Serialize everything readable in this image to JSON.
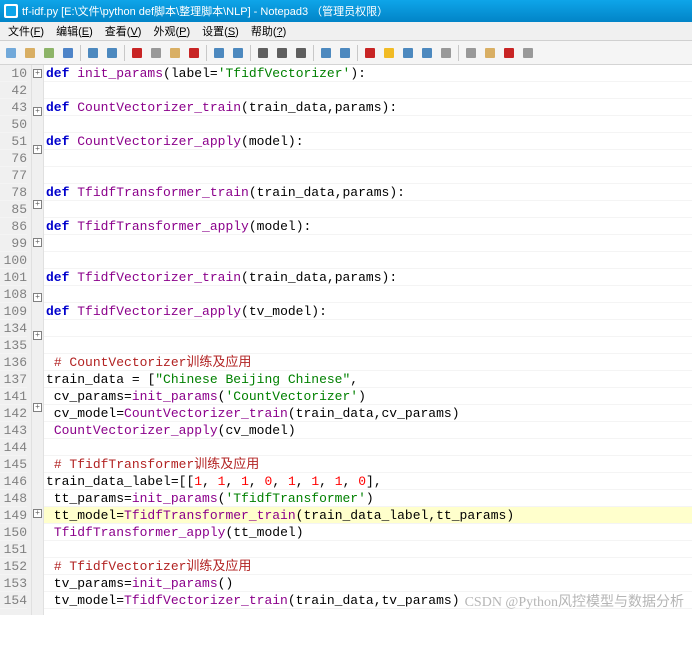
{
  "title": "tf-idf.py [E:\\文件\\python def脚本\\整理脚本\\NLP] - Notepad3 （管理员权限）",
  "menus": [
    "文件(F)",
    "编辑(E)",
    "查看(V)",
    "外观(P)",
    "设置(S)",
    "帮助(?)"
  ],
  "menu_ul": [
    "F",
    "E",
    "V",
    "P",
    "S",
    "?"
  ],
  "watermark": "CSDN @Python风控模型与数据分析",
  "lines": [
    {
      "n": 10,
      "f": "+",
      "t": [
        [
          "kw",
          "def "
        ],
        [
          "fn",
          "init_params"
        ],
        [
          "op",
          "("
        ],
        [
          "var",
          "label"
        ],
        [
          "op",
          "="
        ],
        [
          "str",
          "'TfidfVectorizer'"
        ],
        [
          "op",
          ")"
        ],
        [
          "op",
          ":"
        ]
      ]
    },
    {
      "n": 42,
      "f": "",
      "t": []
    },
    {
      "n": 43,
      "f": "+",
      "t": [
        [
          "kw",
          "def "
        ],
        [
          "fn",
          "CountVectorizer_train"
        ],
        [
          "op",
          "("
        ],
        [
          "var",
          "train_data"
        ],
        [
          "op",
          ","
        ],
        [
          "var",
          "params"
        ],
        [
          "op",
          ")"
        ],
        [
          "op",
          ":"
        ]
      ]
    },
    {
      "n": 50,
      "f": "",
      "t": []
    },
    {
      "n": 51,
      "f": "+",
      "t": [
        [
          "kw",
          "def "
        ],
        [
          "fn",
          "CountVectorizer_apply"
        ],
        [
          "op",
          "("
        ],
        [
          "var",
          "model"
        ],
        [
          "op",
          ")"
        ],
        [
          "op",
          ":"
        ]
      ]
    },
    {
      "n": 76,
      "f": "",
      "t": []
    },
    {
      "n": 77,
      "f": "",
      "t": []
    },
    {
      "n": 78,
      "f": "+",
      "t": [
        [
          "kw",
          "def "
        ],
        [
          "fn",
          "TfidfTransformer_train"
        ],
        [
          "op",
          "("
        ],
        [
          "var",
          "train_data"
        ],
        [
          "op",
          ","
        ],
        [
          "var",
          "params"
        ],
        [
          "op",
          ")"
        ],
        [
          "op",
          ":"
        ]
      ]
    },
    {
      "n": 85,
      "f": "",
      "t": []
    },
    {
      "n": 86,
      "f": "+",
      "t": [
        [
          "kw",
          "def "
        ],
        [
          "fn",
          "TfidfTransformer_apply"
        ],
        [
          "op",
          "("
        ],
        [
          "var",
          "model"
        ],
        [
          "op",
          ")"
        ],
        [
          "op",
          ":"
        ]
      ]
    },
    {
      "n": 99,
      "f": "",
      "t": []
    },
    {
      "n": 100,
      "f": "",
      "t": []
    },
    {
      "n": 101,
      "f": "+",
      "t": [
        [
          "kw",
          "def "
        ],
        [
          "fn",
          "TfidfVectorizer_train"
        ],
        [
          "op",
          "("
        ],
        [
          "var",
          "train_data"
        ],
        [
          "op",
          ","
        ],
        [
          "var",
          "params"
        ],
        [
          "op",
          ")"
        ],
        [
          "op",
          ":"
        ]
      ]
    },
    {
      "n": 108,
      "f": "",
      "t": []
    },
    {
      "n": 109,
      "f": "+",
      "t": [
        [
          "kw",
          "def "
        ],
        [
          "fn",
          "TfidfVectorizer_apply"
        ],
        [
          "op",
          "("
        ],
        [
          "var",
          "tv_model"
        ],
        [
          "op",
          ")"
        ],
        [
          "op",
          ":"
        ]
      ]
    },
    {
      "n": 134,
      "f": "",
      "t": []
    },
    {
      "n": 135,
      "f": "",
      "t": []
    },
    {
      "n": 136,
      "f": "",
      "t": [
        [
          "var",
          " "
        ],
        [
          "cmt",
          "# CountVectorizer训练及应用"
        ]
      ]
    },
    {
      "n": 137,
      "f": "+",
      "t": [
        [
          "var",
          "train_data "
        ],
        [
          "op",
          "= "
        ],
        [
          "op",
          "["
        ],
        [
          "str",
          "\"Chinese Beijing Chinese\""
        ],
        [
          "op",
          ","
        ]
      ]
    },
    {
      "n": 141,
      "f": "",
      "t": [
        [
          "var",
          " cv_params"
        ],
        [
          "op",
          "="
        ],
        [
          "fn",
          "init_params"
        ],
        [
          "op",
          "("
        ],
        [
          "str",
          "'CountVectorizer'"
        ],
        [
          "op",
          ")"
        ]
      ]
    },
    {
      "n": 142,
      "f": "",
      "t": [
        [
          "var",
          " cv_model"
        ],
        [
          "op",
          "="
        ],
        [
          "fn",
          "CountVectorizer_train"
        ],
        [
          "op",
          "("
        ],
        [
          "var",
          "train_data"
        ],
        [
          "op",
          ","
        ],
        [
          "var",
          "cv_params"
        ],
        [
          "op",
          ")"
        ]
      ]
    },
    {
      "n": 143,
      "f": "",
      "t": [
        [
          "var",
          " "
        ],
        [
          "fn",
          "CountVectorizer_apply"
        ],
        [
          "op",
          "("
        ],
        [
          "var",
          "cv_model"
        ],
        [
          "op",
          ")"
        ]
      ]
    },
    {
      "n": 144,
      "f": "",
      "t": []
    },
    {
      "n": 145,
      "f": "",
      "t": [
        [
          "var",
          " "
        ],
        [
          "cmt",
          "# TfidfTransformer训练及应用"
        ]
      ]
    },
    {
      "n": 146,
      "f": "+",
      "t": [
        [
          "var",
          "train_data_label"
        ],
        [
          "op",
          "="
        ],
        [
          "op",
          "[["
        ],
        [
          "num",
          "1"
        ],
        [
          "op",
          ", "
        ],
        [
          "num",
          "1"
        ],
        [
          "op",
          ", "
        ],
        [
          "num",
          "1"
        ],
        [
          "op",
          ", "
        ],
        [
          "num",
          "0"
        ],
        [
          "op",
          ", "
        ],
        [
          "num",
          "1"
        ],
        [
          "op",
          ", "
        ],
        [
          "num",
          "1"
        ],
        [
          "op",
          ", "
        ],
        [
          "num",
          "1"
        ],
        [
          "op",
          ", "
        ],
        [
          "num",
          "0"
        ],
        [
          "op",
          "],"
        ]
      ]
    },
    {
      "n": 148,
      "f": "",
      "t": [
        [
          "var",
          " tt_params"
        ],
        [
          "op",
          "="
        ],
        [
          "fn",
          "init_params"
        ],
        [
          "op",
          "("
        ],
        [
          "str",
          "'TfidfTransformer'"
        ],
        [
          "op",
          ")"
        ]
      ]
    },
    {
      "n": 149,
      "f": "",
      "hl": true,
      "t": [
        [
          "var",
          " tt_model"
        ],
        [
          "op",
          "="
        ],
        [
          "fn",
          "TfidfTransformer_train"
        ],
        [
          "op",
          "("
        ],
        [
          "var",
          "train_data_label"
        ],
        [
          "op",
          ","
        ],
        [
          "var",
          "tt_params"
        ],
        [
          "op",
          ")"
        ]
      ]
    },
    {
      "n": 150,
      "f": "",
      "t": [
        [
          "var",
          " "
        ],
        [
          "fn",
          "TfidfTransformer_apply"
        ],
        [
          "op",
          "("
        ],
        [
          "var",
          "tt_model"
        ],
        [
          "op",
          ")"
        ]
      ]
    },
    {
      "n": 151,
      "f": "",
      "t": []
    },
    {
      "n": 152,
      "f": "",
      "t": [
        [
          "var",
          " "
        ],
        [
          "cmt",
          "# TfidfVectorizer训练及应用"
        ]
      ]
    },
    {
      "n": 153,
      "f": "",
      "t": [
        [
          "var",
          " tv_params"
        ],
        [
          "op",
          "="
        ],
        [
          "fn",
          "init_params"
        ],
        [
          "op",
          "()"
        ]
      ]
    },
    {
      "n": 154,
      "f": "",
      "t": [
        [
          "var",
          " tv_model"
        ],
        [
          "op",
          "="
        ],
        [
          "fn",
          "TfidfVectorizer_train"
        ],
        [
          "op",
          "("
        ],
        [
          "var",
          "train_data"
        ],
        [
          "op",
          ","
        ],
        [
          "var",
          "tv_params"
        ],
        [
          "op",
          ")"
        ]
      ]
    }
  ],
  "toolbar_icons": [
    "new",
    "open",
    "revert",
    "save",
    "undo",
    "redo",
    "cut",
    "copy",
    "paste",
    "delete",
    "find",
    "replace",
    "wrap",
    "ws",
    "font",
    "zoomin",
    "zoomout",
    "pin",
    "star",
    "worddown",
    "wordup",
    "clear",
    "print",
    "folder",
    "exit",
    "settings"
  ]
}
